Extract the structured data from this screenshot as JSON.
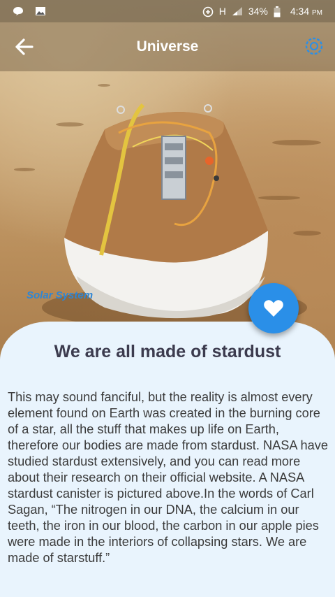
{
  "status_bar": {
    "icons": [
      "message-icon",
      "image-icon",
      "data-saver-icon",
      "signal-icon",
      "battery-icon"
    ],
    "network": "H",
    "battery": "34%",
    "time": "4:34",
    "ampm": "PM"
  },
  "app_bar": {
    "title": "Universe",
    "back_icon": "arrow-left-icon",
    "settings_icon": "gear-icon"
  },
  "hero": {
    "category": "Solar System"
  },
  "fab": {
    "icon": "heart-icon",
    "color": "#2a8fe8"
  },
  "article": {
    "title": "We are all made of stardust",
    "body": "This may sound fanciful, but the reality is almost every element found on Earth was created in the burning core of a star, all the stuff that makes up life on Earth, therefore our bodies are made from stardust. NASA have studied stardust extensively, and you can read more about their research on their official website. A NASA stardust canister is pictured above.In the words of Carl Sagan, “The nitrogen in our DNA, the calcium in our teeth, the iron in our blood, the carbon in our apple pies were made in the interiors of collapsing stars. We are made of starstuff.”"
  },
  "colors": {
    "accent": "#2a8fe8",
    "card_background": "#e9f4fd",
    "title_text": "#3c3b4e",
    "body_text": "#3b3b3b"
  }
}
